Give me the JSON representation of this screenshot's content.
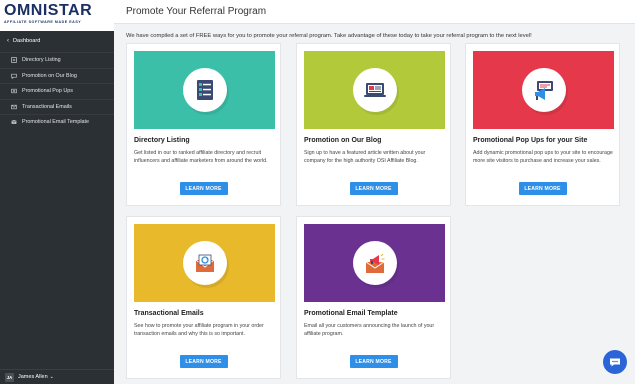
{
  "brand": {
    "name": "OMNISTAR",
    "tagline": "AFFILIATE SOFTWARE MADE EASY"
  },
  "sidebar": {
    "back_label": "Dashboard",
    "items": [
      {
        "label": "Directory Listing",
        "icon": "list-icon"
      },
      {
        "label": "Promotion on Our Blog",
        "icon": "comment-icon"
      },
      {
        "label": "Promotional Pop Ups",
        "icon": "popup-icon"
      },
      {
        "label": "Transactional Emails",
        "icon": "email-icon"
      },
      {
        "label": "Promotional Email Template",
        "icon": "envelope-icon"
      }
    ],
    "user": {
      "initials": "JA",
      "name": "James Allen"
    }
  },
  "header": {
    "title": "Promote Your Referral Program"
  },
  "intro": "We have compiled a set of FREE ways for you to promote your referral program. Take advantage of these today to take your referral program to the next level!",
  "cards": [
    {
      "title": "Directory Listing",
      "description": "Get listed in our to ranked affiliate directory and recruit influencers and affiliate marketers from around the world.",
      "button": "LEARN MORE",
      "color": "#3bbfa9",
      "icon": "directory-list-icon"
    },
    {
      "title": "Promotion on Our Blog",
      "description": "Sign up to have a featured article written about your company for the high authority OSI Affiliate Blog.",
      "button": "LEARN MORE",
      "color": "#b2c93a",
      "icon": "blog-laptop-icon"
    },
    {
      "title": "Promotional Pop Ups for your Site",
      "description": "Add dynamic promotional pop ups to your site to encourage more site visitors to purchase and increase your sales.",
      "button": "LEARN MORE",
      "color": "#e5394b",
      "icon": "megaphone-popup-icon"
    },
    {
      "title": "Transactional Emails",
      "description": "See how to promote your affiliate program in your order transaction emails and why this is so important.",
      "button": "LEARN MORE",
      "color": "#e8b92b",
      "icon": "email-refresh-icon"
    },
    {
      "title": "Promotional Email Template",
      "description": "Email all your customers announcing the launch of your affiliate program.",
      "button": "LEARN MORE",
      "color": "#6a3191",
      "icon": "megaphone-envelope-icon"
    }
  ],
  "colors": {
    "sidebar_bg": "#2b3034",
    "button_blue": "#2e8fe8",
    "chat_bubble": "#2a64d6"
  }
}
